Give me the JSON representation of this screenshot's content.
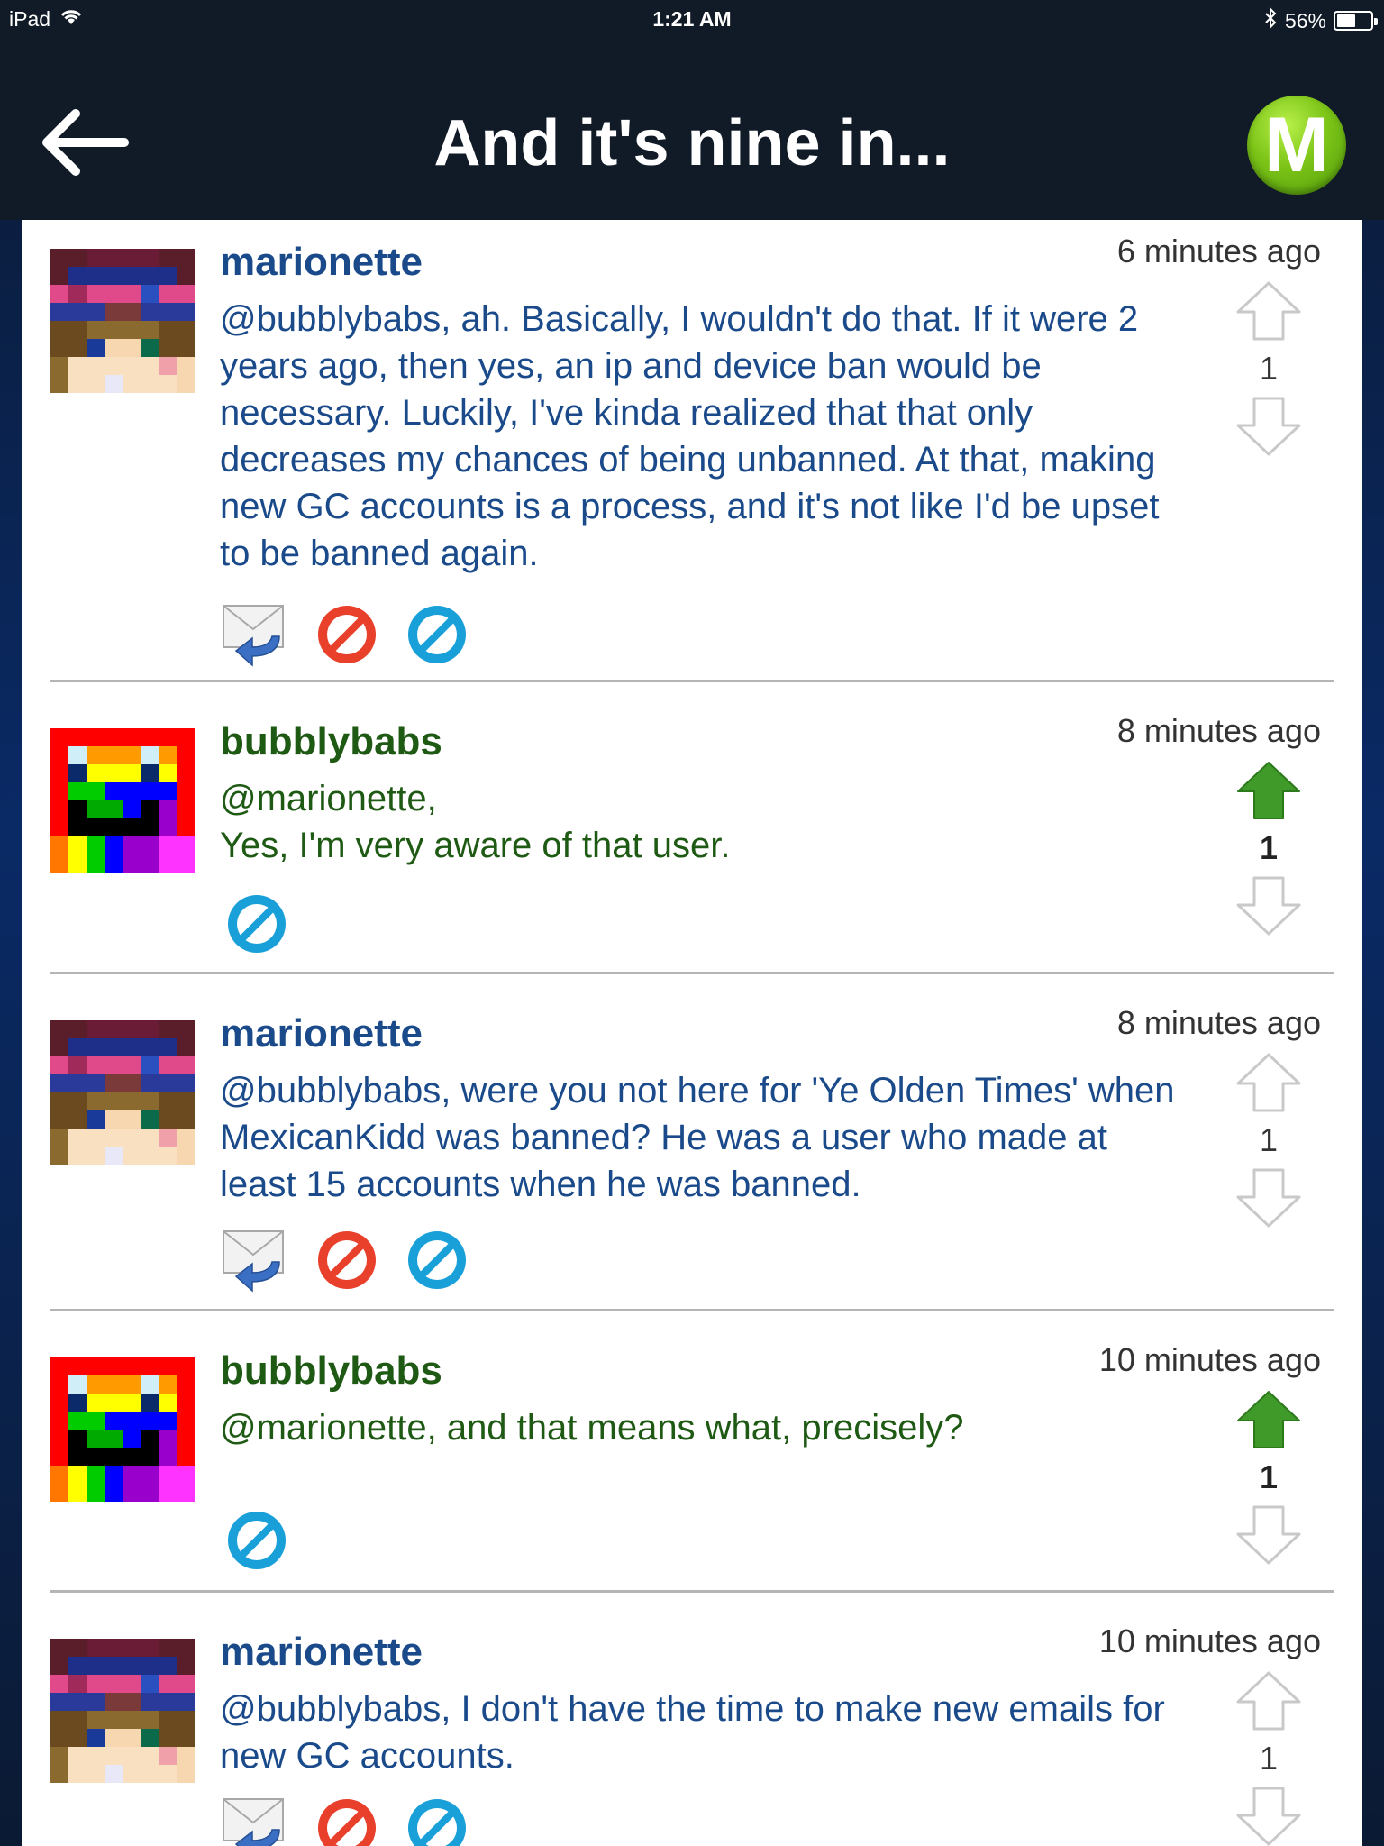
{
  "status_bar": {
    "device": "iPad",
    "time": "1:21 AM",
    "battery": "56%",
    "battery_level": 0.56
  },
  "nav": {
    "title": "And it's nine in...",
    "logo_letter": "M"
  },
  "comments": [
    {
      "author": "marionette",
      "time": "6 minutes ago",
      "body": "@bubblybabs, ah. Basically, I wouldn't do that. If it were 2 years ago, then yes, an ip and device ban would be necessary. Luckily, I've kinda realized that that only decreases my chances of being unbanned. At that, making new GC accounts is a process, and it's not like I'd be upset to be banned again.",
      "votes": "1"
    },
    {
      "author": "bubblybabs",
      "time": "8 minutes ago",
      "body": "@marionette,\nYes, I'm very aware of that user.",
      "votes": "1"
    },
    {
      "author": "marionette",
      "time": "8 minutes ago",
      "body": "@bubblybabs, were you not here for 'Ye Olden Times' when MexicanKidd was banned? He was a user who made at least 15 accounts when he was banned.",
      "votes": "1"
    },
    {
      "author": "bubblybabs",
      "time": "10 minutes ago",
      "body": "@marionette, and that means what, precisely?",
      "votes": "1"
    },
    {
      "author": "marionette",
      "time": "10 minutes ago",
      "body": "@bubblybabs, I don't have the time to make new emails for new GC accounts.",
      "votes": "1"
    }
  ],
  "colors": {
    "marionette_text": "#1a4a8a",
    "bubblybabs_text": "#1f5a14",
    "upvote_active": "#3f9a2a",
    "block_red": "#e8402a",
    "block_blue": "#1aa0d8"
  }
}
